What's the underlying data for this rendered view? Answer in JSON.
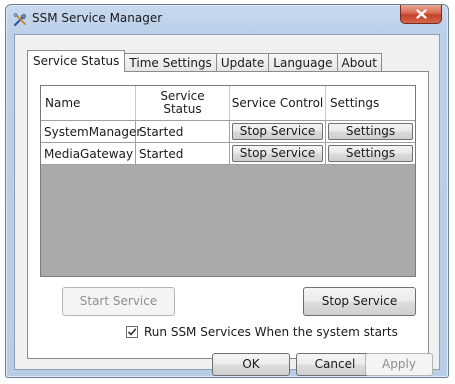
{
  "window": {
    "title": "SSM Service Manager"
  },
  "tabs": [
    {
      "label": "Service Status",
      "active": true
    },
    {
      "label": "Time Settings",
      "active": false
    },
    {
      "label": "Update",
      "active": false
    },
    {
      "label": "Language",
      "active": false
    },
    {
      "label": "About",
      "active": false
    }
  ],
  "table": {
    "columns": [
      "Name",
      "Service\nStatus",
      "Service Control",
      "Settings"
    ],
    "rows": [
      {
        "name": "SystemManager",
        "status": "Started",
        "control": "Stop Service",
        "settings": "Settings"
      },
      {
        "name": "MediaGateway",
        "status": "Started",
        "control": "Stop Service",
        "settings": "Settings"
      }
    ]
  },
  "actions": {
    "start_label": "Start Service",
    "stop_label": "Stop Service"
  },
  "autostart": {
    "label": "Run SSM Services When the system starts",
    "checked": true
  },
  "dialog_buttons": {
    "ok": "OK",
    "cancel": "Cancel",
    "apply": "Apply"
  },
  "icons": {
    "app": "tools-icon",
    "close": "close-icon",
    "checkmark": "checkmark-icon"
  }
}
